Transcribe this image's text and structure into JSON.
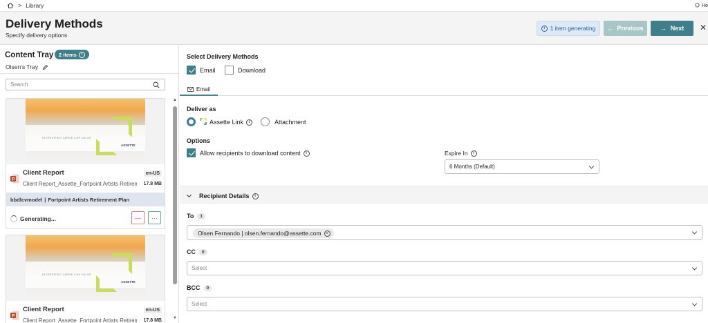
{
  "breadcrumb": {
    "home_icon": "home-icon",
    "separator": ">",
    "current": "Library",
    "help_text": "He"
  },
  "header": {
    "title": "Delivery Methods",
    "subtitle": "Specify delivery options",
    "status_badge": "1 item generating",
    "previous_label": "Previous",
    "next_label": "Next",
    "close_glyph": "✕"
  },
  "tray": {
    "title": "Content Tray",
    "count_badge": "2 items",
    "owner": "Olsen's Tray",
    "search_placeholder": "Search",
    "cards": [
      {
        "slide_text": "DIVERSIFIED LARGE CAP VALUE",
        "slide_logo": "ASSETTE",
        "title": "Client Report",
        "subtitle": "Client Report_Assette_Fortpoint Artists Retirement...",
        "lang": "en-US",
        "size": "17.8 MB",
        "model": "bbdlcvmodel",
        "plan": "Fortpoint Artists Retirement Plan",
        "status": "Generating..."
      },
      {
        "slide_text": "DIVERSIFIED LARGE CAP VALUE",
        "slide_logo": "ASSETTE",
        "title": "Client Report",
        "subtitle": "Client Report_Assette_Fortpoint Artists Retirem...",
        "lang": "en-US",
        "size": "17.8 MB"
      }
    ]
  },
  "delivery": {
    "section_title": "Select Delivery Methods",
    "methods": [
      {
        "label": "Email",
        "checked": true
      },
      {
        "label": "Download",
        "checked": false
      }
    ],
    "tab_label": "Email",
    "deliver_as_title": "Deliver as",
    "deliver_options": [
      {
        "label": "Assette Link",
        "selected": true
      },
      {
        "label": "Attachment",
        "selected": false
      }
    ],
    "options_title": "Options",
    "allow_download_label": "Allow recipients to download content",
    "expire_label": "Expire In",
    "expire_value": "6 Months (Default)"
  },
  "recipients": {
    "title": "Recipient Details",
    "to_label": "To",
    "to_count": "1",
    "to_chip": "Olsen Fernando | olsen.fernando@assette.com",
    "cc_label": "CC",
    "cc_count": "0",
    "cc_placeholder": "Select",
    "bcc_label": "BCC",
    "bcc_count": "0",
    "bcc_placeholder": "Select"
  },
  "colors": {
    "accent": "#3f7f8a",
    "prev_disabled": "#a7c7c6",
    "info_badge_bg": "#dde9f7"
  }
}
